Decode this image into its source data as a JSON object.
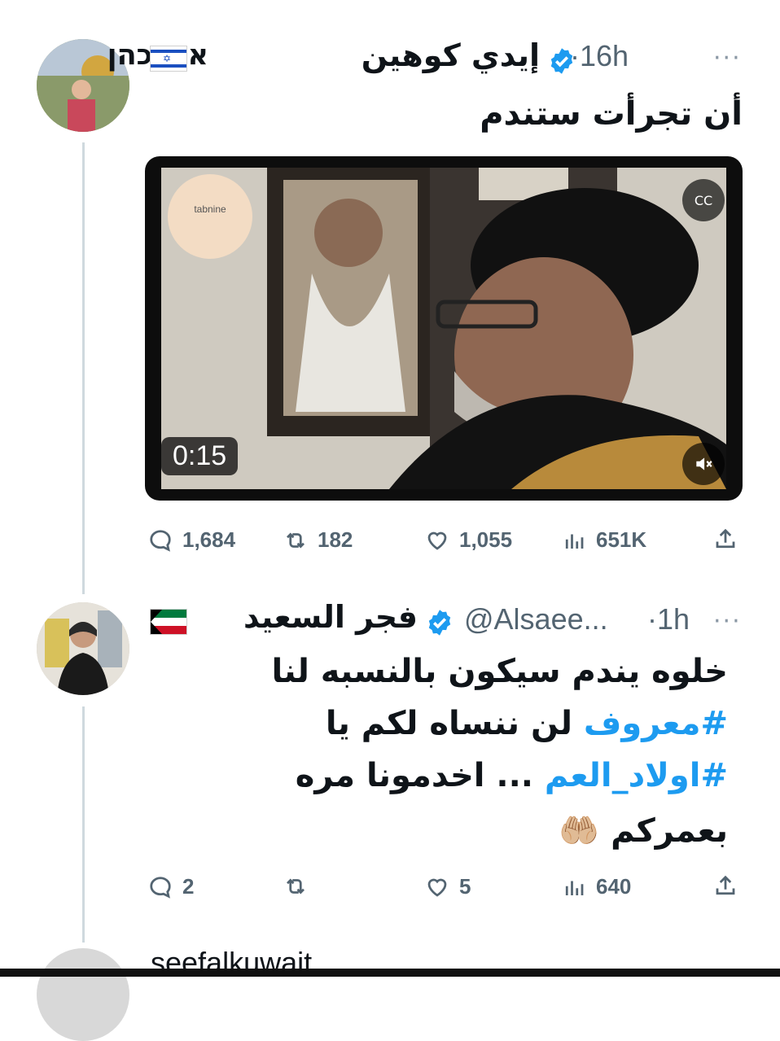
{
  "colors": {
    "accent": "#1d9bf0",
    "secondary_text": "#536471",
    "thread_line": "#cfd9de"
  },
  "tweets": [
    {
      "display_name_ar": "إيدي كوهين",
      "display_name_he": "אדי כהן",
      "flag": "israel-flag",
      "time": "·16h",
      "text_lines": [
        "أن تجرأت ستندم"
      ],
      "media": {
        "duration": "0:15",
        "watermark": "tabnine"
      },
      "actions": {
        "replies": "1,684",
        "retweets": "182",
        "likes": "1,055",
        "views": "651K"
      }
    },
    {
      "display_name": "فجر السعيد",
      "flag": "kuwait-flag",
      "handle": "@Alsaee...",
      "time": "·1h",
      "text_line1": "خلوه يندم سيكون بالنسبه لنا",
      "text_line2_hashtag": "#معروف",
      "text_line2_rest": " لن ننساه  لكم يا",
      "text_line3_hashtag": "#اولاد_العم",
      "text_line3_rest": " ... اخدمونا مره",
      "text_line4": "بعمركم 🤲🏼",
      "actions": {
        "replies": "2",
        "retweets": "",
        "likes": "5",
        "views": "640"
      }
    },
    {
      "display_name": "seefalkuwait"
    }
  ]
}
